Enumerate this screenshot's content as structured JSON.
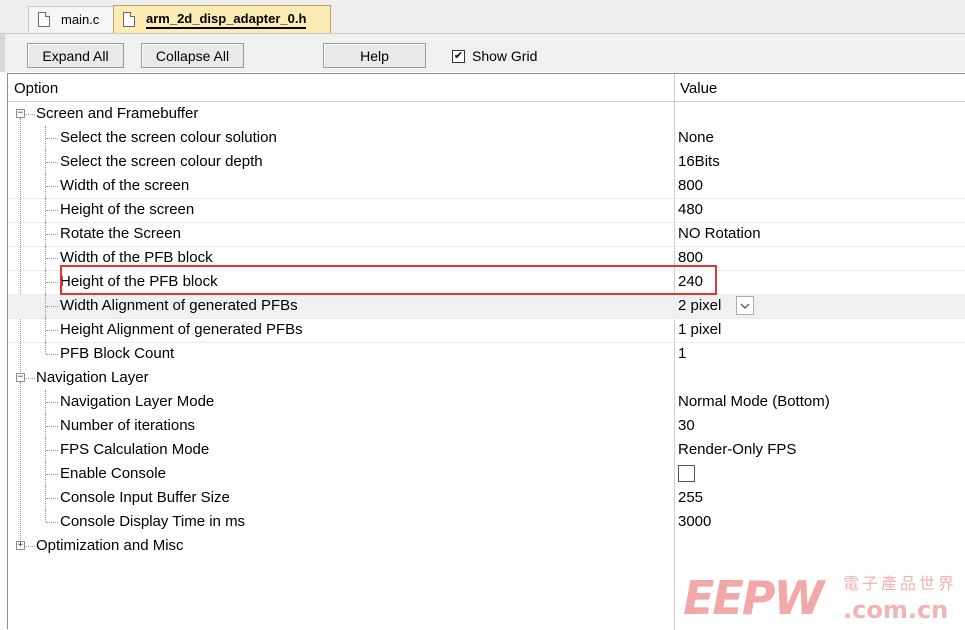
{
  "tabs": [
    {
      "label": "main.c",
      "active": false
    },
    {
      "label": "arm_2d_disp_adapter_0.h",
      "active": true
    }
  ],
  "toolbar": {
    "expand_all": "Expand All",
    "collapse_all": "Collapse All",
    "help": "Help",
    "show_grid": "Show Grid",
    "show_grid_checked": true,
    "check_mark": "✔"
  },
  "grid": {
    "header_option": "Option",
    "header_value": "Value"
  },
  "groups": [
    {
      "label": "Screen and Framebuffer",
      "expanded": true,
      "toggle": "−",
      "items": [
        {
          "label": "Select the screen colour solution",
          "value": "None"
        },
        {
          "label": "Select the screen colour depth",
          "value": "16Bits"
        },
        {
          "label": "Width of the screen",
          "value": "800"
        },
        {
          "label": "Height of the screen",
          "value": "480"
        },
        {
          "label": "Rotate the Screen",
          "value": "NO Rotation"
        },
        {
          "label": "Width of the PFB block",
          "value": "800"
        },
        {
          "label": "Height of the PFB block",
          "value": "240"
        },
        {
          "label": "Width Alignment of generated PFBs",
          "value": "2 pixel"
        },
        {
          "label": "Height Alignment of generated PFBs",
          "value": "1 pixel"
        },
        {
          "label": "PFB Block Count",
          "value": "1"
        }
      ]
    },
    {
      "label": "Navigation Layer",
      "expanded": true,
      "toggle": "−",
      "items": [
        {
          "label": "Navigation Layer Mode",
          "value": "Normal Mode (Bottom)"
        },
        {
          "label": "Number of iterations",
          "value": "30"
        },
        {
          "label": "FPS Calculation Mode",
          "value": "Render-Only FPS"
        },
        {
          "label": "Enable Console",
          "value": "",
          "checked": false
        },
        {
          "label": "Console Input Buffer Size",
          "value": "255"
        },
        {
          "label": "Console Display Time in ms",
          "value": "3000"
        }
      ]
    },
    {
      "label": "Optimization and Misc",
      "expanded": false,
      "toggle": "+"
    }
  ],
  "watermark": {
    "logo": "EEPW",
    "chinese": "電子產品世界",
    "url": ".com.cn"
  },
  "colors": {
    "active_tab": "#fbecb4",
    "highlight_box": "#e03535",
    "watermark": "#f2a8a8"
  }
}
